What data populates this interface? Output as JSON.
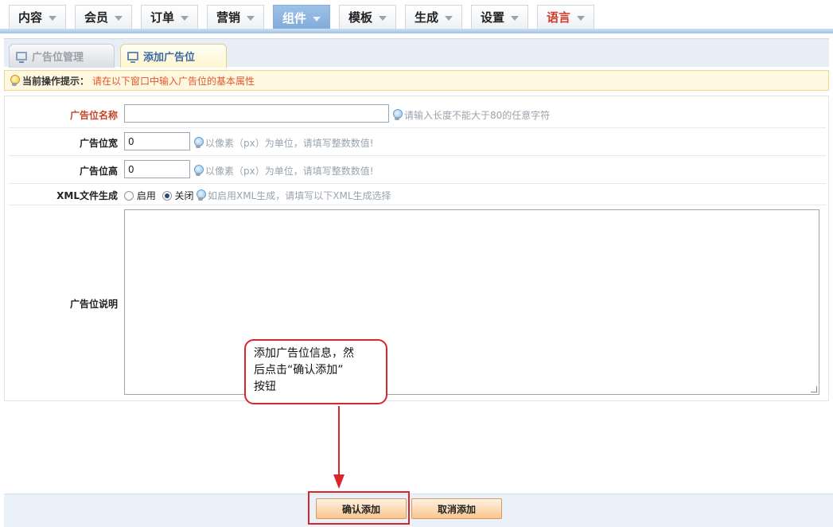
{
  "menu": [
    {
      "label": "内容"
    },
    {
      "label": "会员"
    },
    {
      "label": "订单"
    },
    {
      "label": "营销"
    },
    {
      "label": "组件",
      "active": true
    },
    {
      "label": "模板"
    },
    {
      "label": "生成"
    },
    {
      "label": "设置"
    },
    {
      "label": "语言",
      "color": "#d33a2a"
    }
  ],
  "tabs": {
    "manage": "广告位管理",
    "add": "添加广告位"
  },
  "tip": {
    "label": "当前操作提示：",
    "text": "请在以下窗口中输入广告位的基本属性"
  },
  "form": {
    "name": {
      "label": "广告位名称",
      "value": "",
      "hint": "请输入长度不能大于80的任意字符"
    },
    "width": {
      "label": "广告位宽",
      "value": "0",
      "hint": "以像素（px）为单位，请填写整数数值!"
    },
    "height": {
      "label": "广告位高",
      "value": "0",
      "hint": "以像素（px）为单位，请填写整数数值!"
    },
    "xml": {
      "label": "XML文件生成",
      "on_label": "启用",
      "off_label": "关闭",
      "selected": "关闭",
      "hint": "如启用XML生成，请填写以下XML生成选择"
    },
    "description": {
      "label": "广告位说明",
      "value": ""
    }
  },
  "callout": {
    "line1": "添加广告位信息，然",
    "line2": "后点击“确认添加”",
    "line3": "按钮"
  },
  "buttons": {
    "confirm": "确认添加",
    "cancel": "取消添加"
  },
  "colors": {
    "accent_red": "#d9262a",
    "active_menu": "#8fb6e0",
    "tip_text": "#e2572c"
  }
}
